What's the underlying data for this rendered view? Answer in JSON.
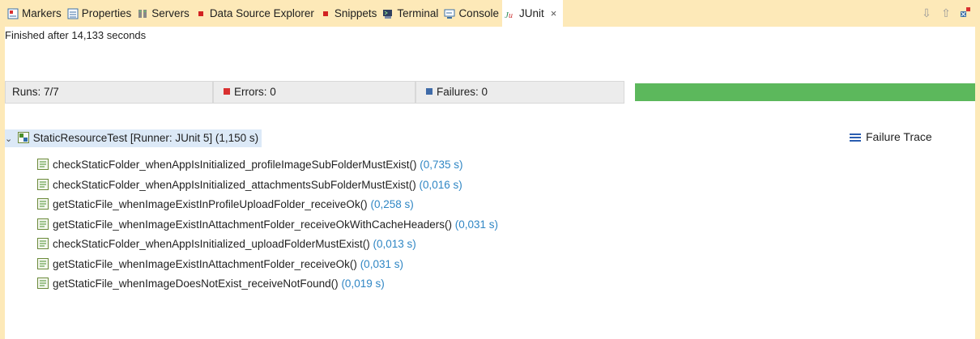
{
  "tabs": [
    {
      "label": "Markers",
      "icon": "markers-icon",
      "color": "#3a6ea5"
    },
    {
      "label": "Properties",
      "icon": "properties-icon",
      "color": "#3a6ea5"
    },
    {
      "label": "Servers",
      "icon": "servers-icon",
      "color": "#555555"
    },
    {
      "label": "Data Source Explorer",
      "icon": "data-source-icon",
      "color": "#d22222"
    },
    {
      "label": "Snippets",
      "icon": "snippets-icon",
      "color": "#d22222"
    },
    {
      "label": "Terminal",
      "icon": "terminal-icon",
      "color": "#3a6ea5"
    },
    {
      "label": "Console",
      "icon": "console-icon",
      "color": "#3a6ea5"
    },
    {
      "label": "JUnit",
      "icon": "junit-icon",
      "color": "#2e8b57",
      "active": true
    }
  ],
  "tab_close_glyph": "×",
  "status": "Finished after 14,133 seconds",
  "runs": {
    "label": "Runs:",
    "value": "7/7"
  },
  "errors": {
    "label": "Errors:",
    "value": "0"
  },
  "failures": {
    "label": "Failures:",
    "value": "0"
  },
  "progress": {
    "fraction": 1.0,
    "color": "#5cb85c"
  },
  "failure_trace": "Failure Trace",
  "tree": {
    "root": {
      "label": "StaticResourceTest [Runner: JUnit 5]",
      "time": "(1,150 s)"
    },
    "tests": [
      {
        "label": "checkStaticFolder_whenAppIsInitialized_profileImageSubFolderMustExist()",
        "time": "(0,735 s)"
      },
      {
        "label": "checkStaticFolder_whenAppIsInitialized_attachmentsSubFolderMustExist()",
        "time": "(0,016 s)"
      },
      {
        "label": "getStaticFile_whenImageExistInProfileUploadFolder_receiveOk()",
        "time": "(0,258 s)"
      },
      {
        "label": "getStaticFile_whenImageExistInAttachmentFolder_receiveOkWithCacheHeaders()",
        "time": "(0,031 s)"
      },
      {
        "label": "checkStaticFolder_whenAppIsInitialized_uploadFolderMustExist()",
        "time": "(0,013 s)"
      },
      {
        "label": "getStaticFile_whenImageExistInAttachmentFolder_receiveOk()",
        "time": "(0,031 s)"
      },
      {
        "label": "getStaticFile_whenImageDoesNotExist_receiveNotFound()",
        "time": "(0,019 s)"
      }
    ]
  }
}
